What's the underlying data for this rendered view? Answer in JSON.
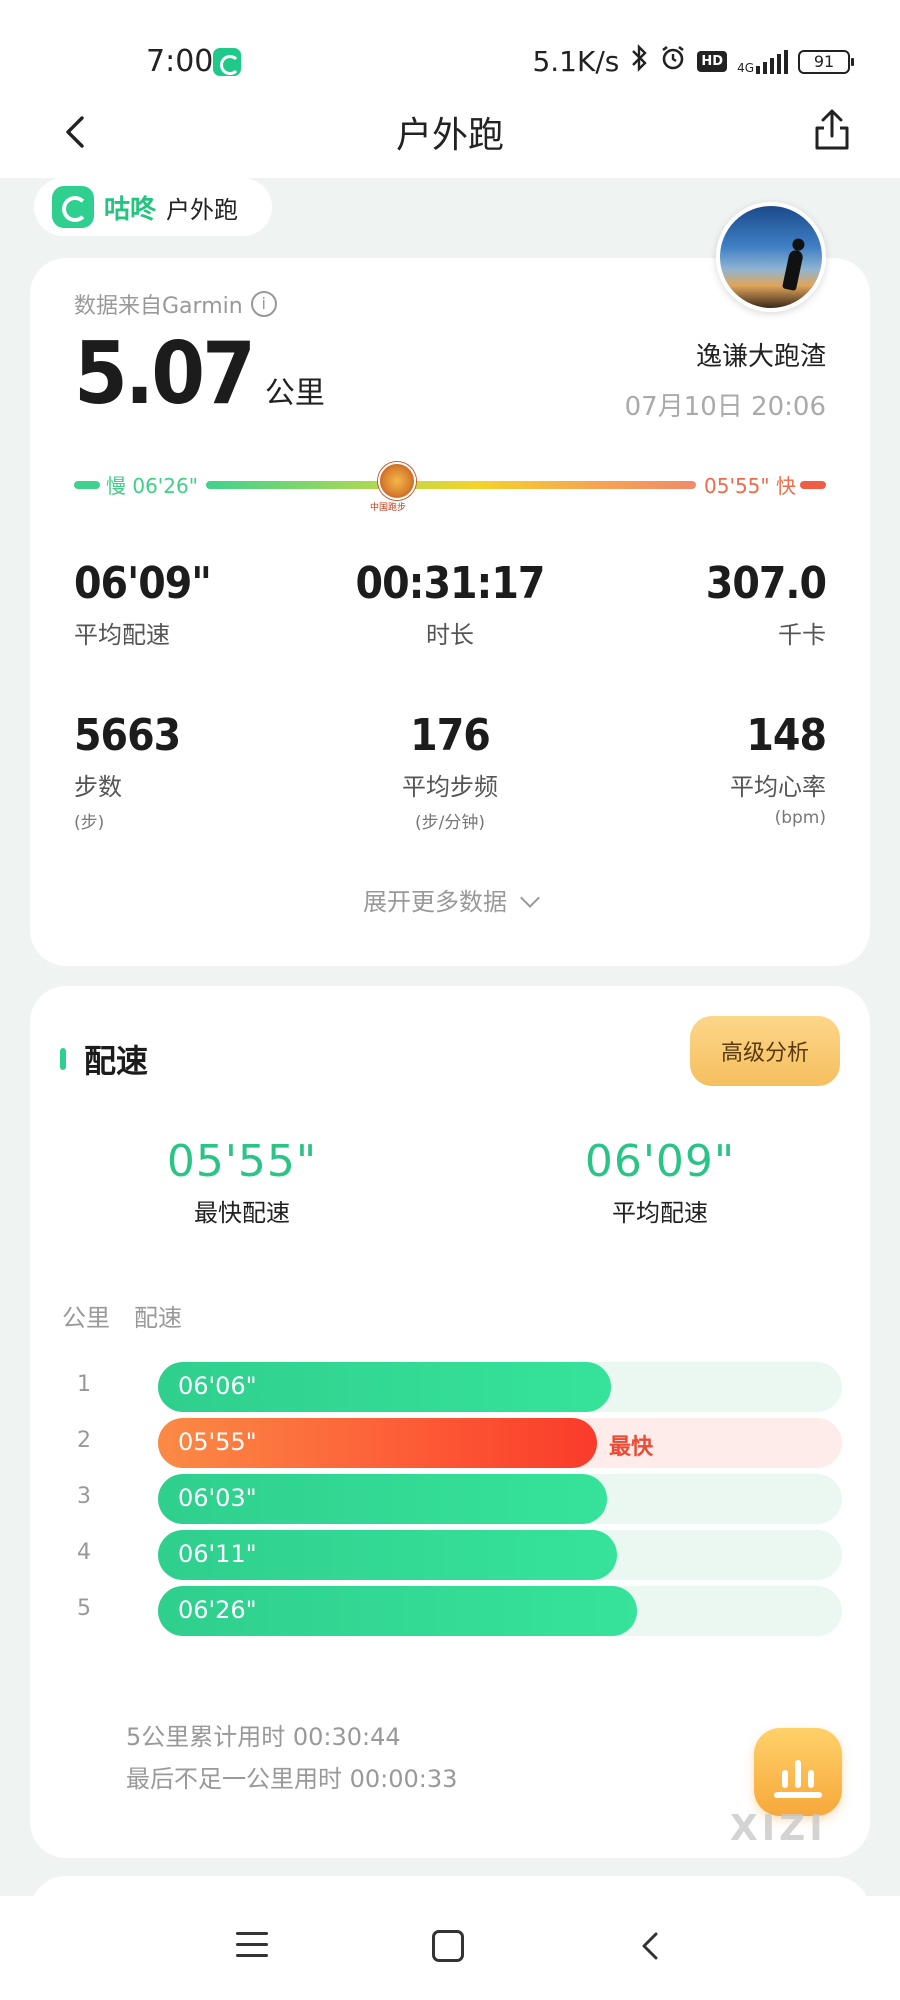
{
  "status_bar": {
    "time": "7:00",
    "speed": "5.1K/s",
    "network": "4G",
    "battery": "91"
  },
  "header": {
    "title": "户外跑"
  },
  "tag": {
    "brand": "咕咚",
    "type": "户外跑"
  },
  "summary_card": {
    "source": "数据来自Garmin",
    "distance": "5.07",
    "distance_unit": "公里",
    "user_name": "逸谦大跑渣",
    "datetime": "07月10日 20:06",
    "pace_range": {
      "slow_label": "慢 06'26\"",
      "fast_label": "05'55\" 快",
      "badge_text": "中国跑步"
    },
    "stats": [
      {
        "value": "06'09\"",
        "label": "平均配速",
        "unit": ""
      },
      {
        "value": "00:31:17",
        "label": "时长",
        "unit": ""
      },
      {
        "value": "307.0",
        "label": "千卡",
        "unit": ""
      },
      {
        "value": "5663",
        "label": "步数",
        "unit": "(步)"
      },
      {
        "value": "176",
        "label": "平均步频",
        "unit": "(步/分钟)"
      },
      {
        "value": "148",
        "label": "平均心率",
        "unit": "(bpm)"
      }
    ],
    "expand_label": "展开更多数据"
  },
  "pace_card": {
    "title": "配速",
    "advanced_button": "高级分析",
    "fastest_value": "05'55\"",
    "fastest_label": "最快配速",
    "average_value": "06'09\"",
    "average_label": "平均配速",
    "col_km": "公里",
    "col_pace": "配速",
    "splits": [
      {
        "km": "1",
        "pace": "06'06\"",
        "seconds": 366,
        "fastest": false,
        "fill": 0.662
      },
      {
        "km": "2",
        "pace": "05'55\"",
        "seconds": 355,
        "fastest": true,
        "fill": 0.642,
        "tag": "最快"
      },
      {
        "km": "3",
        "pace": "06'03\"",
        "seconds": 363,
        "fastest": false,
        "fill": 0.656
      },
      {
        "km": "4",
        "pace": "06'11\"",
        "seconds": 371,
        "fastest": false,
        "fill": 0.671
      },
      {
        "km": "5",
        "pace": "06'26\"",
        "seconds": 386,
        "fastest": false,
        "fill": 0.7
      }
    ],
    "cumulative": "5公里累计用时 00:30:44",
    "remainder": "最后不足一公里用时 00:00:33"
  },
  "watermark": "XIZI",
  "colors": {
    "accent_green": "#2ac486",
    "fast_red": "#fa3b2a",
    "gold": "#f5bf5f"
  }
}
